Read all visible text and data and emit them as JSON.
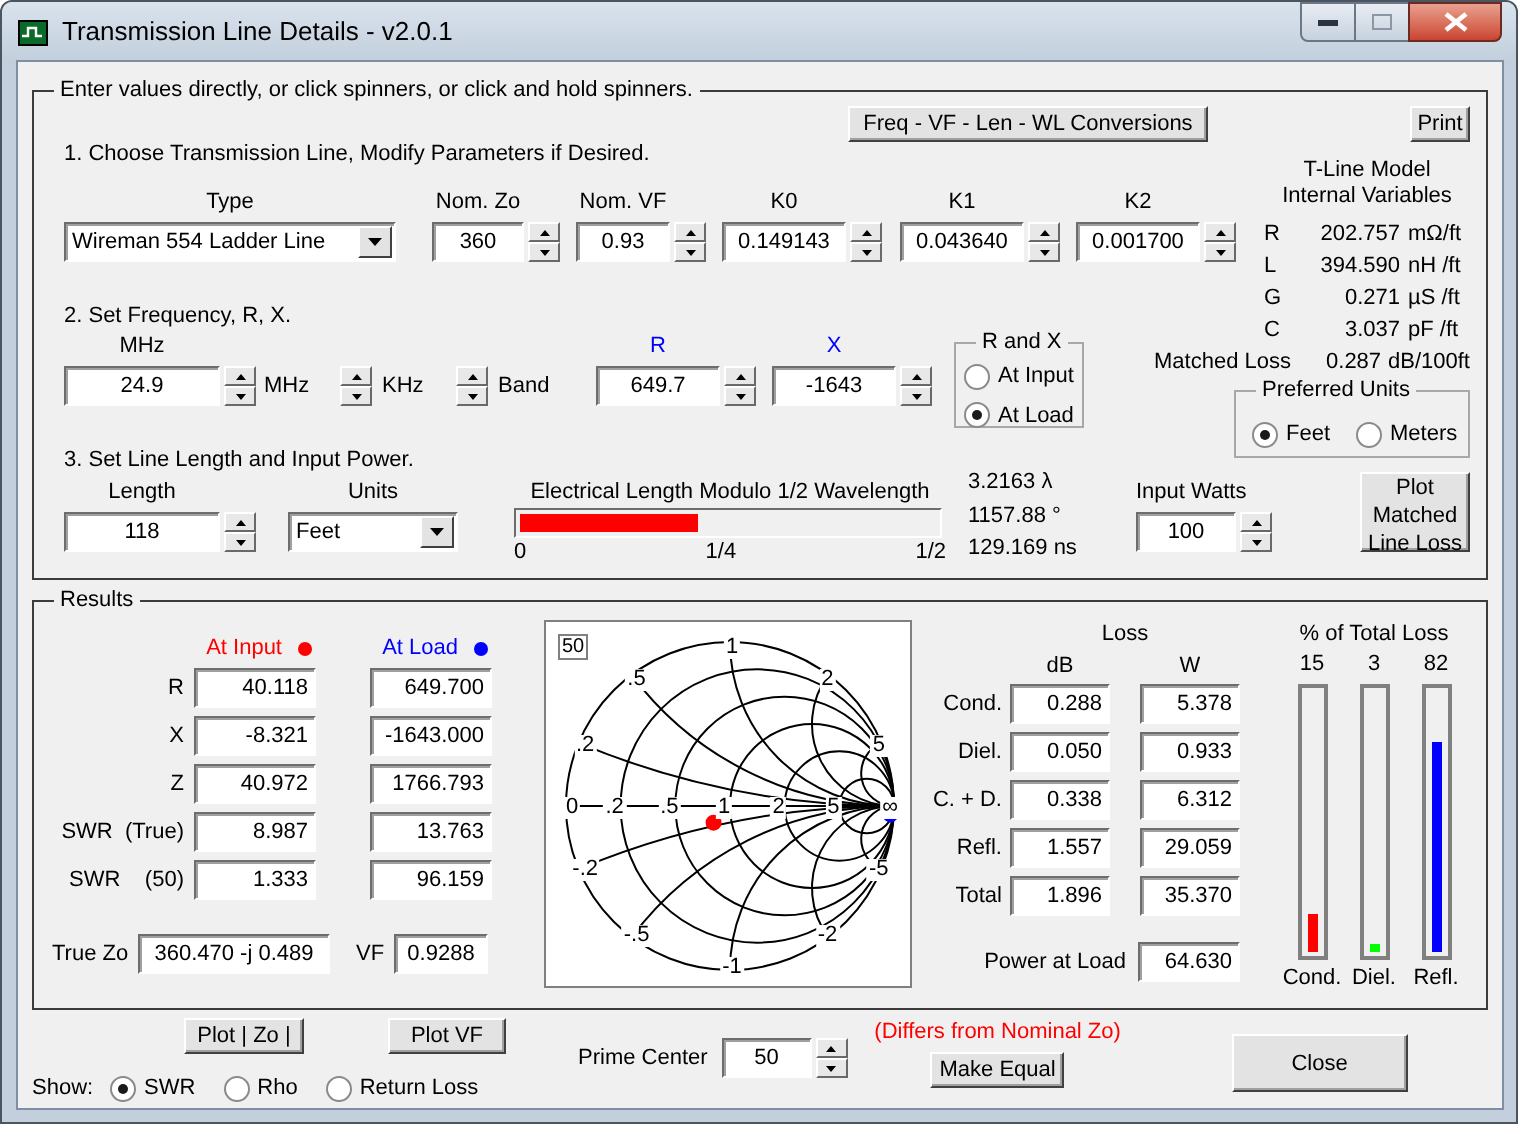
{
  "window": {
    "title": "Transmission Line Details - v2.0.1"
  },
  "setup": {
    "legend": "Enter values directly, or click spinners, or click and hold spinners.",
    "conversions_button": "Freq - VF - Len - WL Conversions",
    "print_button": "Print",
    "step1": "1. Choose Transmission Line, Modify Parameters if Desired.",
    "line_type": {
      "label": "Type",
      "value": "Wireman 554 Ladder Line"
    },
    "parameters": [
      {
        "label": "Nom. Zo",
        "value": "360"
      },
      {
        "label": "Nom. VF",
        "value": "0.93"
      },
      {
        "label": "K0",
        "value": "0.149143"
      },
      {
        "label": "K1",
        "value": "0.043640"
      },
      {
        "label": "K2",
        "value": "0.001700"
      }
    ],
    "step2": "2. Set Frequency, R, X.",
    "frequency": {
      "label": "MHz",
      "value": "24.9"
    },
    "spin_labels": [
      "MHz",
      "KHz",
      "Band"
    ],
    "impedance": [
      {
        "label": "R",
        "value": "649.7"
      },
      {
        "label": "X",
        "value": "-1643"
      }
    ],
    "rx_location": {
      "title": "R and X",
      "options": [
        {
          "label": "At Input",
          "selected": false
        },
        {
          "label": "At Load",
          "selected": true
        }
      ]
    },
    "step3": "3. Set Line Length and Input Power.",
    "length": {
      "label": "Length",
      "value": "118"
    },
    "units": {
      "label": "Units",
      "value": "Feet"
    },
    "electrical_length": {
      "title": "Electrical Length Modulo 1/2 Wavelength",
      "level": 0.43,
      "ticks": [
        "0",
        "1/4",
        "1/2"
      ],
      "readings": [
        "3.2163 λ",
        "1157.88 °",
        "129.169 ns"
      ]
    },
    "input_watts": {
      "label": "Input Watts",
      "value": "100"
    },
    "plot_loss_button": "Plot Matched Line Loss"
  },
  "model": {
    "title": "T-Line Model Internal Variables",
    "rows": [
      {
        "name": "R",
        "value": "202.757",
        "unit": "mΩ/ft"
      },
      {
        "name": "L",
        "value": "394.590",
        "unit": "nH /ft"
      },
      {
        "name": "G",
        "value": "0.271",
        "unit": "µS /ft"
      },
      {
        "name": "C",
        "value": "3.037",
        "unit": "pF /ft"
      }
    ],
    "matched_loss": {
      "label": "Matched Loss",
      "value": "0.287",
      "unit": "dB/100ft"
    }
  },
  "preferred_units": {
    "title": "Preferred Units",
    "options": [
      {
        "label": "Feet",
        "selected": true
      },
      {
        "label": "Meters",
        "selected": false
      }
    ]
  },
  "results": {
    "legend": "Results",
    "columns": [
      {
        "label": "At Input",
        "color": "#ff0000"
      },
      {
        "label": "At Load",
        "color": "#0000ff"
      }
    ],
    "rows": [
      {
        "label": "R",
        "values": [
          "40.118",
          "649.700"
        ]
      },
      {
        "label": "X",
        "values": [
          "-8.321",
          "-1643.000"
        ]
      },
      {
        "label": "Z",
        "values": [
          "40.972",
          "1766.793"
        ]
      },
      {
        "label": "SWR  (True)",
        "values": [
          "8.987",
          "13.763"
        ]
      },
      {
        "label": "SWR    (50)",
        "values": [
          "1.333",
          "96.159"
        ]
      }
    ],
    "true_zo": {
      "label": "True Zo",
      "value": "360.470 -j 0.489"
    },
    "vf": {
      "label": "VF",
      "value": "0.9288"
    },
    "smith_chart": {
      "reference": "50",
      "resistance_labels": [
        "0",
        ".2",
        ".5",
        "1",
        "2",
        "5",
        "∞"
      ],
      "reactance_labels": [
        ".2",
        ".5",
        "1",
        "2",
        "5",
        "-5",
        "-2",
        "-1",
        "-.5",
        "-.2"
      ]
    },
    "loss": {
      "title": "Loss",
      "columns": [
        "dB",
        "W"
      ],
      "rows": [
        {
          "label": "Cond.",
          "values": [
            "0.288",
            "5.378"
          ]
        },
        {
          "label": "Diel.",
          "values": [
            "0.050",
            "0.933"
          ]
        },
        {
          "label": "C. + D.",
          "values": [
            "0.338",
            "6.312"
          ]
        },
        {
          "label": "Refl.",
          "values": [
            "1.557",
            "29.059"
          ]
        },
        {
          "label": "Total",
          "values": [
            "1.896",
            "35.370"
          ]
        }
      ],
      "power_at_load": {
        "label": "Power at Load",
        "value": "64.630"
      }
    },
    "loss_share": {
      "title": "% of Total Loss",
      "bars": [
        {
          "label": "Cond.",
          "value": "15",
          "level": 0.15,
          "color": "#ff0000"
        },
        {
          "label": "Diel.",
          "value": "3",
          "level": 0.03,
          "color": "#00ff00"
        },
        {
          "label": "Refl.",
          "value": "82",
          "level": 0.82,
          "color": "#0000ff"
        }
      ]
    }
  },
  "bottom": {
    "plot_zo_button": "Plot | Zo |",
    "plot_vf_button": "Plot VF",
    "show": {
      "label": "Show:",
      "options": [
        {
          "label": "SWR",
          "selected": true
        },
        {
          "label": "Rho",
          "selected": false
        },
        {
          "label": "Return Loss",
          "selected": false
        }
      ]
    },
    "prime_center": {
      "label": "Prime Center",
      "value": "50"
    },
    "warning": "(Differs from Nominal Zo)",
    "make_equal_button": "Make Equal",
    "close_button": "Close"
  }
}
